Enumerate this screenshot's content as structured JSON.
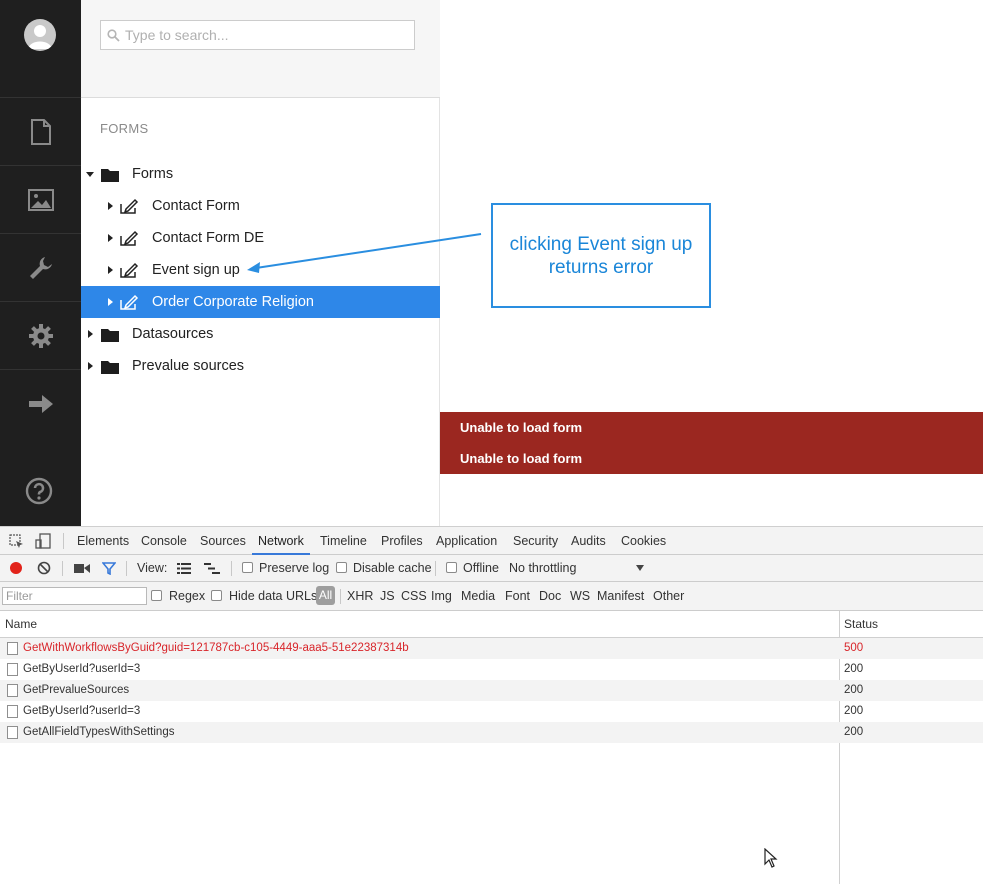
{
  "search": {
    "placeholder": "Type to search..."
  },
  "tree": {
    "section_title": "FORMS",
    "nodes": [
      {
        "label": "Forms"
      },
      {
        "label": "Contact Form"
      },
      {
        "label": "Contact Form DE"
      },
      {
        "label": "Event sign up"
      },
      {
        "label": "Order Corporate Religion"
      },
      {
        "label": "Datasources"
      },
      {
        "label": "Prevalue sources"
      }
    ]
  },
  "annotation": {
    "text": "clicking Event sign up returns error"
  },
  "errors": [
    "Unable to load form",
    "Unable to load form"
  ],
  "devtools": {
    "tabs": [
      "Elements",
      "Console",
      "Sources",
      "Network",
      "Timeline",
      "Profiles",
      "Application",
      "Security",
      "Audits",
      "Cookies"
    ],
    "active_tab": "Network",
    "toolbar": {
      "view_label": "View:",
      "preserve_log": "Preserve log",
      "disable_cache": "Disable cache",
      "offline": "Offline",
      "throttling": "No throttling"
    },
    "filterbar": {
      "filter_placeholder": "Filter",
      "regex": "Regex",
      "hide_data_urls": "Hide data URLs",
      "types": [
        "All",
        "XHR",
        "JS",
        "CSS",
        "Img",
        "Media",
        "Font",
        "Doc",
        "WS",
        "Manifest",
        "Other"
      ]
    },
    "columns": {
      "name": "Name",
      "status": "Status"
    },
    "requests": [
      {
        "name": "GetWithWorkflowsByGuid?guid=121787cb-c105-4449-aaa5-51e22387314b",
        "status": "500"
      },
      {
        "name": "GetByUserId?userId=3",
        "status": "200"
      },
      {
        "name": "GetPrevalueSources",
        "status": "200"
      },
      {
        "name": "GetByUserId?userId=3",
        "status": "200"
      },
      {
        "name": "GetAllFieldTypesWithSettings",
        "status": "200"
      }
    ]
  },
  "colors": {
    "sidebar": "#1f1f1f",
    "selected": "#2e87e8",
    "error_bg": "#9b2720",
    "annotation": "#2a8ee0",
    "error_text": "#d8252a"
  }
}
